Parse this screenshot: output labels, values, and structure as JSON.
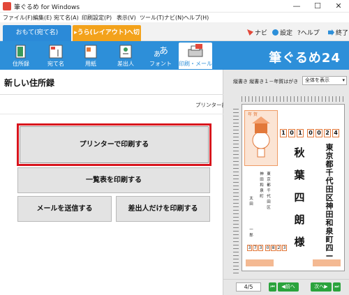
{
  "window": {
    "title": "筆ぐるめ for Windows",
    "minimize": "—",
    "maximize": "☐",
    "close": "✕"
  },
  "menu": [
    "ファイル(F)",
    "編集(E)",
    "宛て名(A)",
    "印刷設定(P)",
    "表示(V)",
    "ツール(T)",
    "ナビ(N)",
    "ヘルプ(H)"
  ],
  "mode_tabs": {
    "front": "おもて(宛て名)",
    "back": "▸うら(レイアウト)へ切替"
  },
  "quick_links": {
    "navi": "ナビ",
    "settings": "設定",
    "help": "?ヘルプ",
    "exit": "終了"
  },
  "nav_buttons": [
    "住所録",
    "宛て名",
    "用紙",
    "差出人",
    "フォント",
    "印刷・メール"
  ],
  "brand": "筆ぐるめ24",
  "left_panel": {
    "title": "新しい住所録",
    "printer_settings": "プリンター設定",
    "print_button": "プリンターで印刷する",
    "list_print_button": "一覧表を印刷する",
    "mail_button": "メールを送信する",
    "sender_print_button": "差出人だけを印刷する"
  },
  "preview": {
    "label": "縦書き 縦書き１－年賀はがき",
    "view_select": "全体を表示",
    "postcard_label": "年 賀",
    "zip_digits": [
      "1",
      "0",
      "1",
      "0",
      "0",
      "2",
      "4"
    ],
    "recipient_chars": [
      "秋",
      "葉",
      "四",
      "朗",
      "様"
    ],
    "address_chars": [
      "東",
      "京",
      "都",
      "千",
      "代",
      "田",
      "区",
      "神",
      "田",
      "和",
      "泉",
      "町",
      "四",
      "ー",
      "一"
    ],
    "sender_zip_digits": [
      "3",
      "7",
      "3",
      "0",
      "8",
      "2",
      "3"
    ],
    "page_indicator": "4/5",
    "prev_label": "前へ",
    "next_label": "次へ"
  },
  "colors": {
    "accent_blue": "#2d8fd9",
    "accent_orange": "#f3a21b",
    "highlight_red": "#d8141d",
    "brand_green": "#2aa33c"
  }
}
